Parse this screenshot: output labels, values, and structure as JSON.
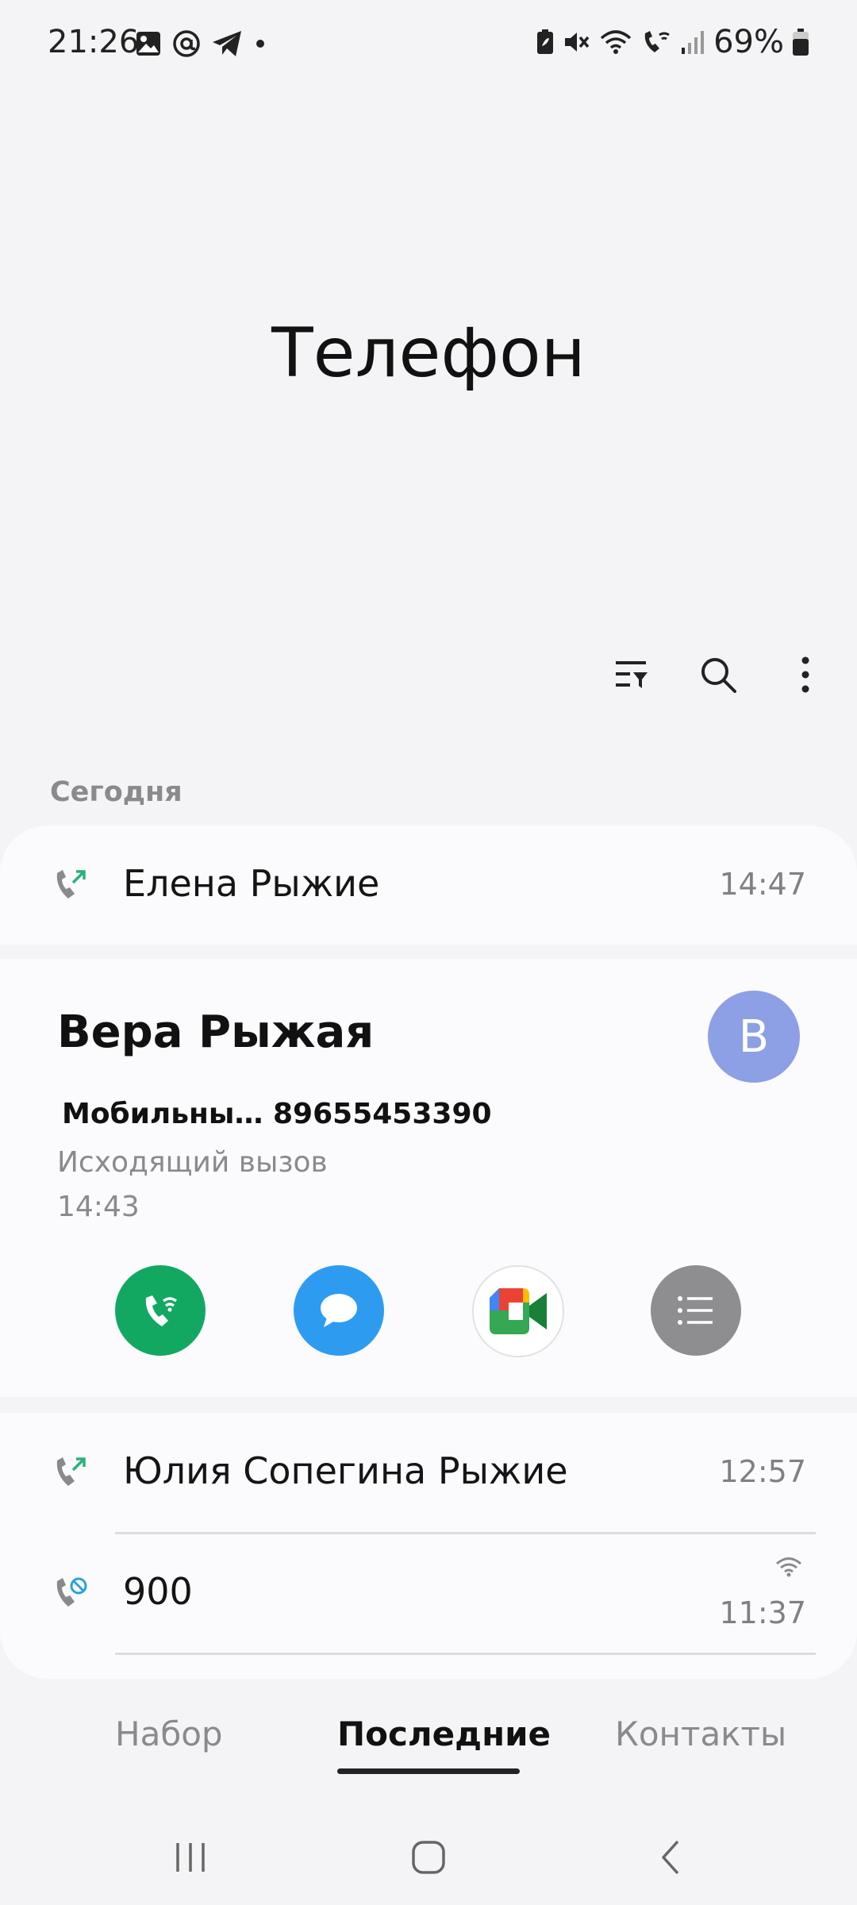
{
  "status_bar": {
    "time": "21:26",
    "battery": "69%",
    "left_icons": [
      "image-icon",
      "at-icon",
      "telegram-icon",
      "dot-icon"
    ],
    "right_icons": [
      "battery-saver-icon",
      "mute-icon",
      "wifi-icon",
      "wifi-calling-icon",
      "signal-icon",
      "battery-icon"
    ]
  },
  "header": {
    "title": "Телефон"
  },
  "toolbar": {
    "icons": [
      "filter-icon",
      "search-icon",
      "more-vert-icon"
    ]
  },
  "section": {
    "today_label": "Сегодня"
  },
  "calls": [
    {
      "name": "Елена Рыжие",
      "time": "14:47",
      "icon": "outgoing-call-icon"
    },
    {
      "name": "Юлия Сопегина Рыжие",
      "time": "12:57",
      "icon": "outgoing-call-icon"
    },
    {
      "name": "900",
      "time": "11:37",
      "icon": "blocked-call-icon",
      "extra_icon": "wifi-icon"
    }
  ],
  "expanded": {
    "name": "Вера Рыжая",
    "avatar_letter": "В",
    "number": "Мобильны… 89655453390",
    "call_type": "Исходящий вызов",
    "time": "14:43",
    "actions": [
      "wifi-call-button",
      "message-button",
      "video-call-button",
      "details-button"
    ]
  },
  "tabs": [
    "Набор",
    "Последние",
    "Контакты"
  ],
  "active_tab": "Последние",
  "colors": {
    "call_green": "#12a862",
    "message_blue": "#2d9cf0",
    "details_gray": "#8e8e90",
    "avatar": "#8d9fe5",
    "outgoing_arrow": "#28b27a"
  }
}
